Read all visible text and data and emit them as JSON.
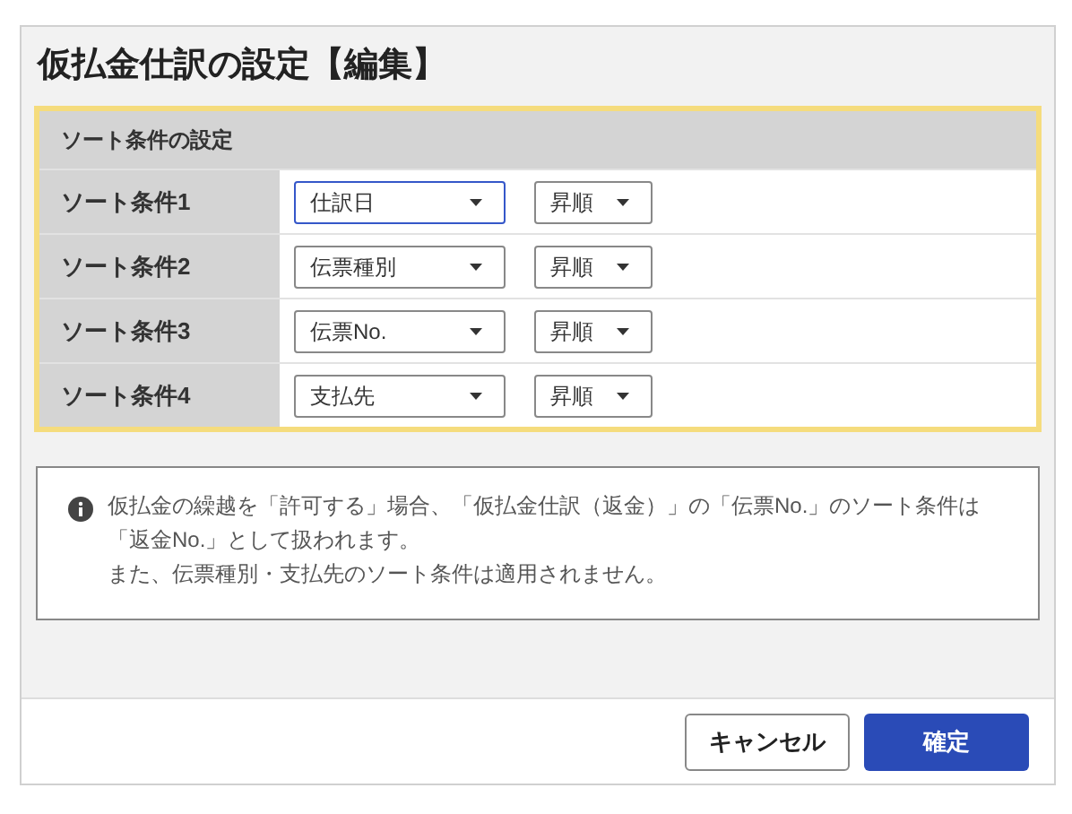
{
  "dialog": {
    "title": "仮払金仕訳の設定【編集】"
  },
  "sort_panel": {
    "header": "ソート条件の設定",
    "rows": [
      {
        "label": "ソート条件1",
        "field": {
          "value": "仕訳日",
          "focused": true
        },
        "order": {
          "value": "昇順",
          "focused": false
        }
      },
      {
        "label": "ソート条件2",
        "field": {
          "value": "伝票種別",
          "focused": false
        },
        "order": {
          "value": "昇順",
          "focused": false
        }
      },
      {
        "label": "ソート条件3",
        "field": {
          "value": "伝票No.",
          "focused": false
        },
        "order": {
          "value": "昇順",
          "focused": false
        }
      },
      {
        "label": "ソート条件4",
        "field": {
          "value": "支払先",
          "focused": false
        },
        "order": {
          "value": "昇順",
          "focused": false
        }
      }
    ]
  },
  "notice": {
    "lines": [
      "仮払金の繰越を「許可する」場合、「仮払金仕訳（返金）」の「伝票No.」のソート条件は「返金No.」として扱われます。",
      "また、伝票種別・支払先のソート条件は適用されません。"
    ]
  },
  "buttons": [
    {
      "label": "キャンセル",
      "kind": "secondary"
    },
    {
      "label": "確定",
      "kind": "primary"
    }
  ]
}
